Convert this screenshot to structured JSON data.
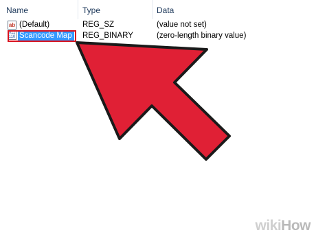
{
  "columns": {
    "name": "Name",
    "type": "Type",
    "data": "Data"
  },
  "rows": [
    {
      "name": "(Default)",
      "type": "REG_SZ",
      "data": "(value not set)",
      "icon": "string-value-icon"
    },
    {
      "name": "Scancode Map",
      "type": "REG_BINARY",
      "data": "(zero-length binary value)",
      "icon": "binary-value-icon"
    }
  ],
  "icons": {
    "string_glyph": "ab",
    "binary_glyph": "011 110"
  },
  "colors": {
    "selection": "#3399ff",
    "highlight_box": "#d9121e",
    "arrow": "#e02035",
    "arrow_outline": "#1a1a1a"
  },
  "watermark": {
    "prefix": "wiki",
    "suffix": "How"
  }
}
